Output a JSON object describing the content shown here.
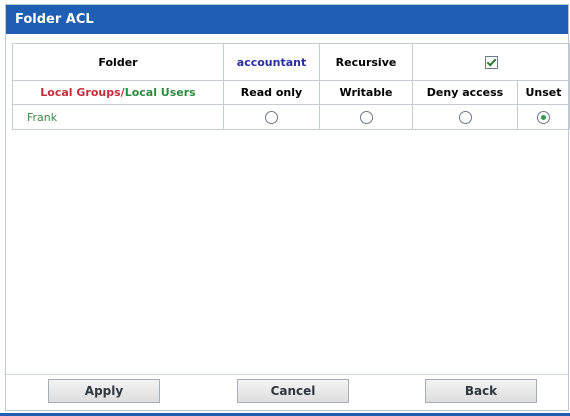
{
  "header": {
    "title": "Folder ACL"
  },
  "acl": {
    "row1": {
      "folder_label": "Folder",
      "folder_value": "accountant",
      "recursive_label": "Recursive",
      "recursive_checked": true
    },
    "row2": {
      "groups_label": "Local Groups",
      "slash": "/",
      "users_label": "Local Users",
      "read_only": "Read only",
      "writable": "Writable",
      "deny_access": "Deny access",
      "unset": "Unset"
    },
    "user": {
      "name": "Frank",
      "selected_permission": "Unset"
    }
  },
  "footer": {
    "apply": "Apply",
    "cancel": "Cancel",
    "back": "Back"
  }
}
